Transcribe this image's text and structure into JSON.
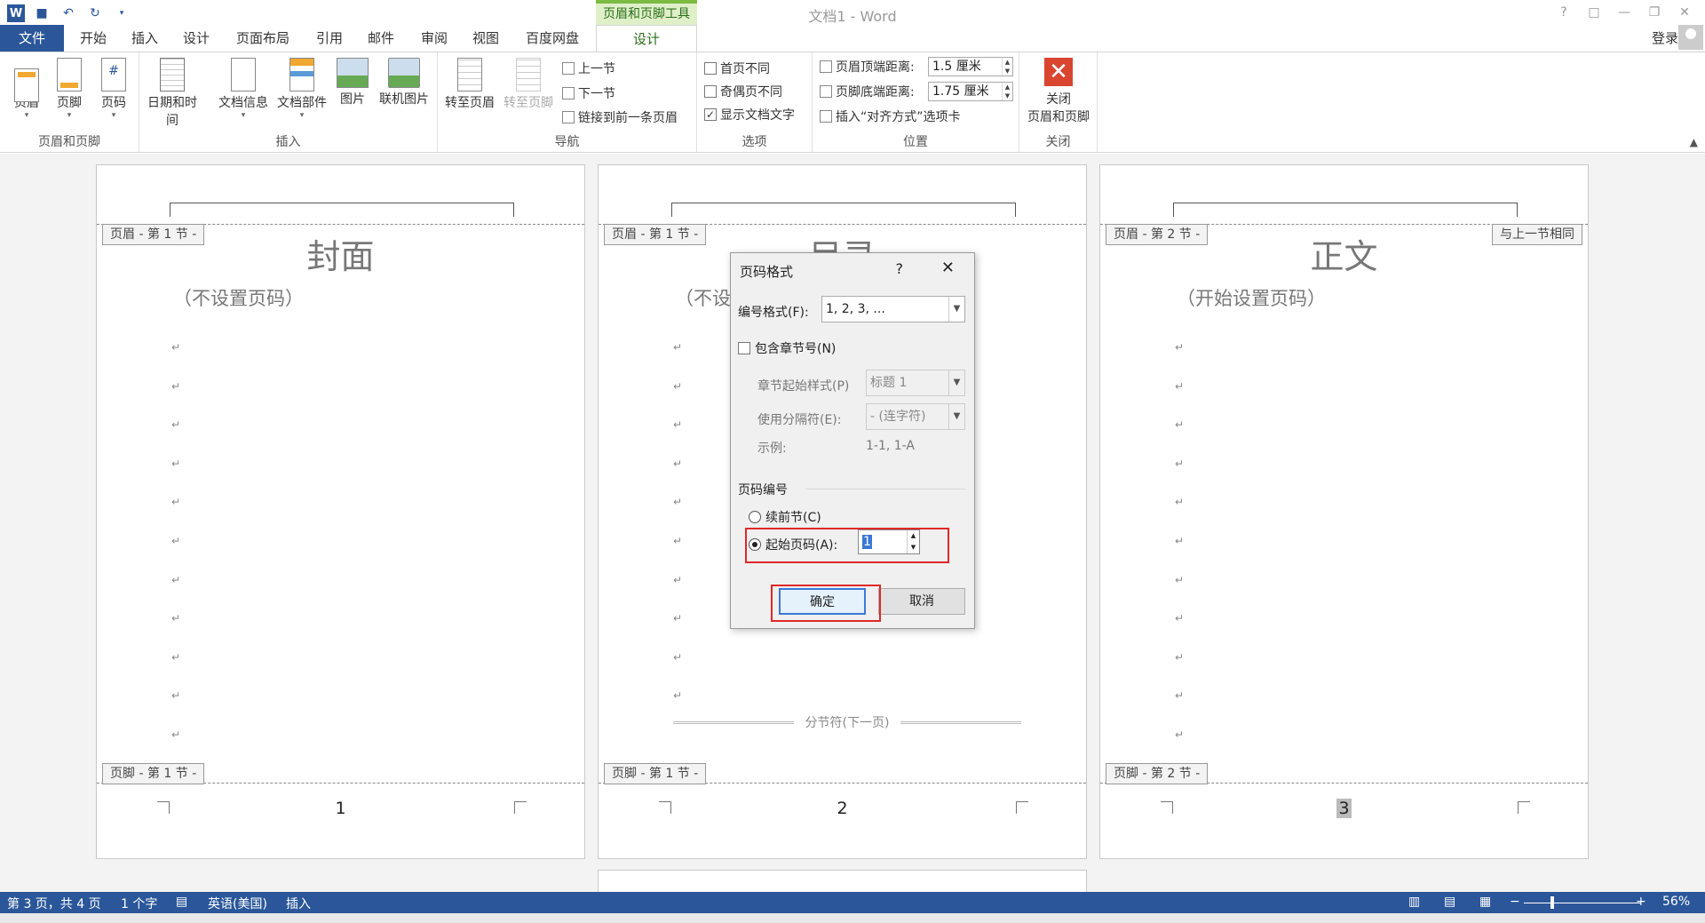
{
  "titlebar": {
    "doc_title": "文档1 - Word",
    "contextual_tools": "页眉和页脚工具",
    "help": "?",
    "restore": "□",
    "minimize": "—",
    "maximize": "❐",
    "close": "✕"
  },
  "tabs": {
    "file": "文件",
    "items": [
      "开始",
      "插入",
      "设计",
      "页面布局",
      "引用",
      "邮件",
      "审阅",
      "视图",
      "百度网盘"
    ],
    "active": "设计",
    "login": "登录"
  },
  "ribbon": {
    "header_footer": {
      "name": "页眉和页脚",
      "header": "页眉",
      "footer": "页脚",
      "page_number": "页码"
    },
    "insert": {
      "name": "插入",
      "datetime": "日期和时间",
      "docinfo": "文档信息",
      "docparts": "文档部件",
      "picture": "图片",
      "online_picture": "联机图片"
    },
    "navigation": {
      "name": "导航",
      "goto_header": "转至页眉",
      "goto_footer": "转至页脚",
      "prev_section": "上一节",
      "next_section": "下一节",
      "link_previous": "链接到前一条页眉"
    },
    "options": {
      "name": "选项",
      "diff_first": "首页不同",
      "diff_odd_even": "奇偶页不同",
      "show_doc_text": "显示文档文字"
    },
    "position": {
      "name": "位置",
      "header_top": "页眉顶端距离:",
      "header_top_val": "1.5 厘米",
      "footer_bottom": "页脚底端距离:",
      "footer_bottom_val": "1.75 厘米",
      "insert_align_tab": "插入“对齐方式”选项卡"
    },
    "close": {
      "name": "关闭",
      "close_label_1": "关闭",
      "close_label_2": "页眉和页脚"
    }
  },
  "pages": [
    {
      "header_tag": "页眉 - 第 1 节 -",
      "footer_tag": "页脚 - 第 1 节 -",
      "title": "封面",
      "subtitle": "（不设置页码）",
      "page_num": "1"
    },
    {
      "header_tag": "页眉 - 第 1 节 -",
      "footer_tag": "页脚 - 第 1 节 -",
      "title": "目录",
      "subtitle": "（不设",
      "section_break": "分节符(下一页)",
      "page_num": "2"
    },
    {
      "header_tag": "页眉 - 第 2 节 -",
      "footer_tag": "页脚 - 第 2 节 -",
      "same_as_prev": "与上一节相同",
      "title": "正文",
      "subtitle": "（开始设置页码）",
      "page_num": "3"
    }
  ],
  "para_mark": "↵",
  "dialog": {
    "title": "页码格式",
    "help": "?",
    "close": "✕",
    "number_format_label": "编号格式(F):",
    "number_format_value": "1, 2, 3, ...",
    "include_chapter": "包含章节号(N)",
    "chapter_style_label": "章节起始样式(P)",
    "chapter_style_value": "标题 1",
    "separator_label": "使用分隔符(E):",
    "separator_value": "-  (连字符)",
    "example_label": "示例:",
    "example_value": "1-1, 1-A",
    "numbering_section": "页码编号",
    "continue_prev": "续前节(C)",
    "start_at": "起始页码(A):",
    "start_at_value": "1",
    "ok": "确定",
    "cancel": "取消",
    "highlight_color": "#e02828"
  },
  "statusbar": {
    "page": "第 3 页，共 4 页",
    "words": "1 个字",
    "language": "英语(美国)",
    "mode": "插入",
    "zoom": "56%",
    "minus": "−",
    "plus": "+"
  }
}
